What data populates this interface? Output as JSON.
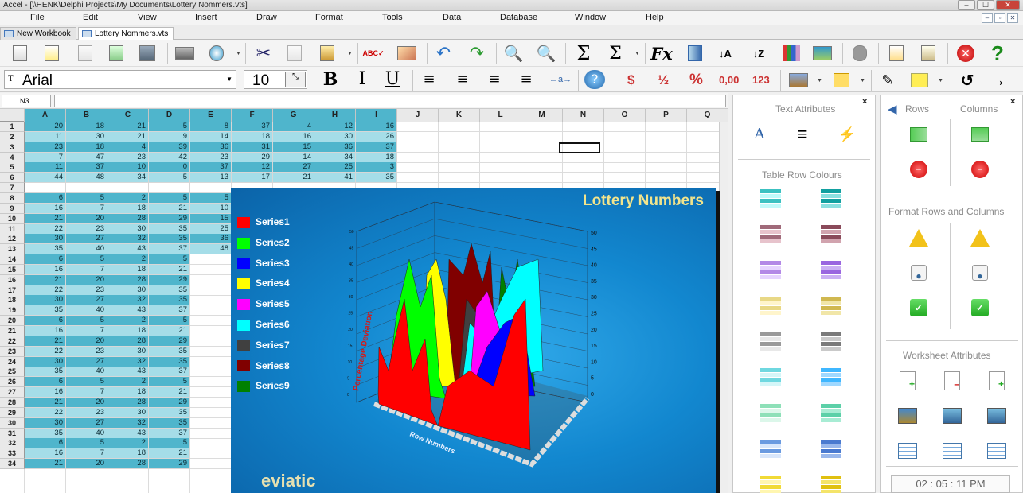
{
  "app": {
    "title": "Accel - [\\\\HENK\\Delphi Projects\\My Documents\\Lottery Nommers.vts]",
    "window_controls": [
      "–",
      "☐",
      "✕"
    ],
    "mdi_controls": [
      "–",
      "▫",
      "✕"
    ]
  },
  "menu": [
    "File",
    "Edit",
    "View",
    "Insert",
    "Draw",
    "Format",
    "Tools",
    "Data",
    "Database",
    "Window",
    "Help"
  ],
  "tabs": [
    {
      "label": "New Workbook"
    },
    {
      "label": "Lottery Nommers.vts"
    }
  ],
  "toolbar2": {
    "font_name": "Arial",
    "font_size": "10",
    "bold": "B",
    "italic": "I",
    "underline": "U",
    "currency": "$",
    "fraction": "½",
    "percent": "%",
    "decimal": "0,00",
    "number": "123"
  },
  "refbar": {
    "cell_ref": "N3"
  },
  "grid": {
    "columns": [
      "A",
      "B",
      "C",
      "D",
      "E",
      "F",
      "G",
      "H",
      "I",
      "J",
      "K",
      "L",
      "M",
      "N",
      "O",
      "P",
      "Q"
    ],
    "rows": [
      "1",
      "2",
      "3",
      "4",
      "5",
      "6",
      "7",
      "8",
      "9",
      "10",
      "11",
      "12",
      "13",
      "14",
      "15",
      "16",
      "17",
      "18",
      "19",
      "20",
      "21",
      "22",
      "23",
      "24",
      "25",
      "26",
      "27",
      "28",
      "29",
      "30",
      "31",
      "32",
      "33",
      "34"
    ],
    "top_block": [
      [
        "20",
        "18",
        "21",
        "5",
        "8",
        "37",
        "4",
        "12",
        "16"
      ],
      [
        "11",
        "30",
        "21",
        "9",
        "14",
        "18",
        "16",
        "30",
        "26"
      ],
      [
        "23",
        "18",
        "4",
        "39",
        "36",
        "31",
        "15",
        "36",
        "37"
      ],
      [
        "7",
        "47",
        "23",
        "42",
        "23",
        "29",
        "14",
        "34",
        "18"
      ],
      [
        "11",
        "37",
        "10",
        "0",
        "37",
        "12",
        "27",
        "25",
        "3"
      ],
      [
        "44",
        "48",
        "34",
        "5",
        "13",
        "17",
        "21",
        "41",
        "35"
      ]
    ],
    "block_rows": [
      [
        "6",
        "5",
        "2",
        "5",
        "5"
      ],
      [
        "16",
        "7",
        "18",
        "21",
        "10"
      ],
      [
        "21",
        "20",
        "28",
        "29",
        "15"
      ],
      [
        "22",
        "23",
        "30",
        "35",
        "25"
      ],
      [
        "30",
        "27",
        "32",
        "35",
        "36"
      ],
      [
        "35",
        "40",
        "43",
        "37",
        "48"
      ]
    ]
  },
  "chart_data": {
    "type": "area",
    "title": "Lottery Numbers",
    "xlabel": "Row Numbers",
    "ylabel": "Percentage Deviation",
    "ylim": [
      0,
      50
    ],
    "y_ticks": [
      "0",
      "5",
      "10",
      "15",
      "20",
      "25",
      "30",
      "35",
      "40",
      "45",
      "50"
    ],
    "legend_position": "left",
    "series": [
      {
        "name": "Series1",
        "color": "#ff0000"
      },
      {
        "name": "Series2",
        "color": "#00ff00"
      },
      {
        "name": "Series3",
        "color": "#0000ff"
      },
      {
        "name": "Series4",
        "color": "#ffff00"
      },
      {
        "name": "Series5",
        "color": "#ff00ff"
      },
      {
        "name": "Series6",
        "color": "#00ffff"
      },
      {
        "name": "Series7",
        "color": "#404040"
      },
      {
        "name": "Series8",
        "color": "#800000"
      },
      {
        "name": "Series9",
        "color": "#008000"
      }
    ],
    "bottom_text": "eviatic"
  },
  "panels": {
    "text_attributes": "Text Attributes",
    "table_row_colours": "Table Row Colours",
    "rows": "Rows",
    "columns": "Columns",
    "format_rows_columns": "Format Rows and Columns",
    "worksheet_attributes": "Worksheet Attributes",
    "close": "×"
  },
  "clock": "02 : 05 : 11  PM",
  "colors": {
    "cell_dark": "#4fb5cc",
    "cell_light": "#a5dde8",
    "chart_bg": "#1287cf",
    "chart_title": "#f2e48c"
  }
}
